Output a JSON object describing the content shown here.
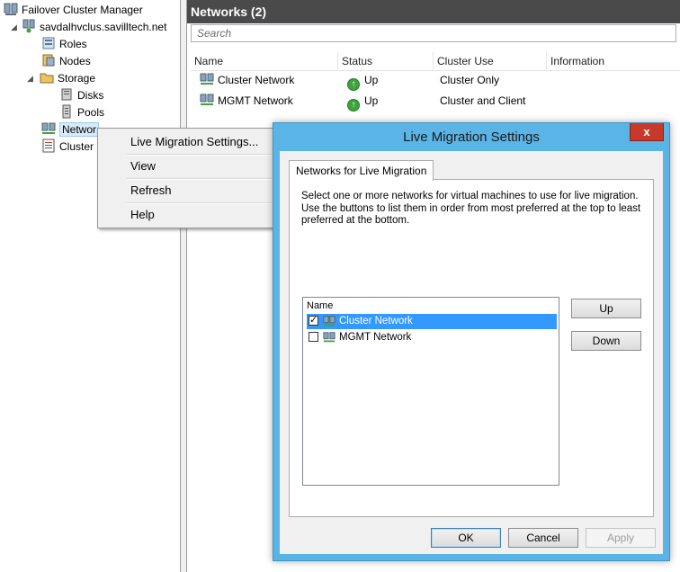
{
  "tree": {
    "root": "Failover Cluster Manager",
    "cluster": "savdalhvclus.savilltech.net",
    "roles": "Roles",
    "nodes": "Nodes",
    "storage": "Storage",
    "disks": "Disks",
    "pools": "Pools",
    "networks": "Networ",
    "events": "Cluster"
  },
  "pane": {
    "title": "Networks (2)",
    "search_placeholder": "Search",
    "columns": [
      "Name",
      "Status",
      "Cluster Use",
      "Information"
    ],
    "rows": [
      {
        "name": "Cluster Network",
        "status": "Up",
        "cluster_use": "Cluster Only",
        "information": ""
      },
      {
        "name": "MGMT Network",
        "status": "Up",
        "cluster_use": "Cluster and Client",
        "information": ""
      }
    ]
  },
  "context_menu": {
    "items": [
      "Live Migration Settings...",
      "View",
      "Refresh",
      "Help"
    ]
  },
  "dialog": {
    "title": "Live Migration Settings",
    "close_label": "x",
    "tab_label": "Networks for Live Migration",
    "description": "Select one or more networks for virtual machines to use for live migration. Use the buttons to list them in order from most preferred at the top to least preferred at the bottom.",
    "list_header": "Name",
    "networks": [
      {
        "name": "Cluster Network",
        "checked": true,
        "selected": true
      },
      {
        "name": "MGMT Network",
        "checked": false,
        "selected": false
      }
    ],
    "up_label": "Up",
    "down_label": "Down",
    "ok_label": "OK",
    "cancel_label": "Cancel",
    "apply_label": "Apply"
  },
  "colors": {
    "title_bar": "#5ab4e6",
    "close_button": "#c7392b",
    "selection": "#3399ff",
    "pane_header": "#4a4a4a"
  }
}
